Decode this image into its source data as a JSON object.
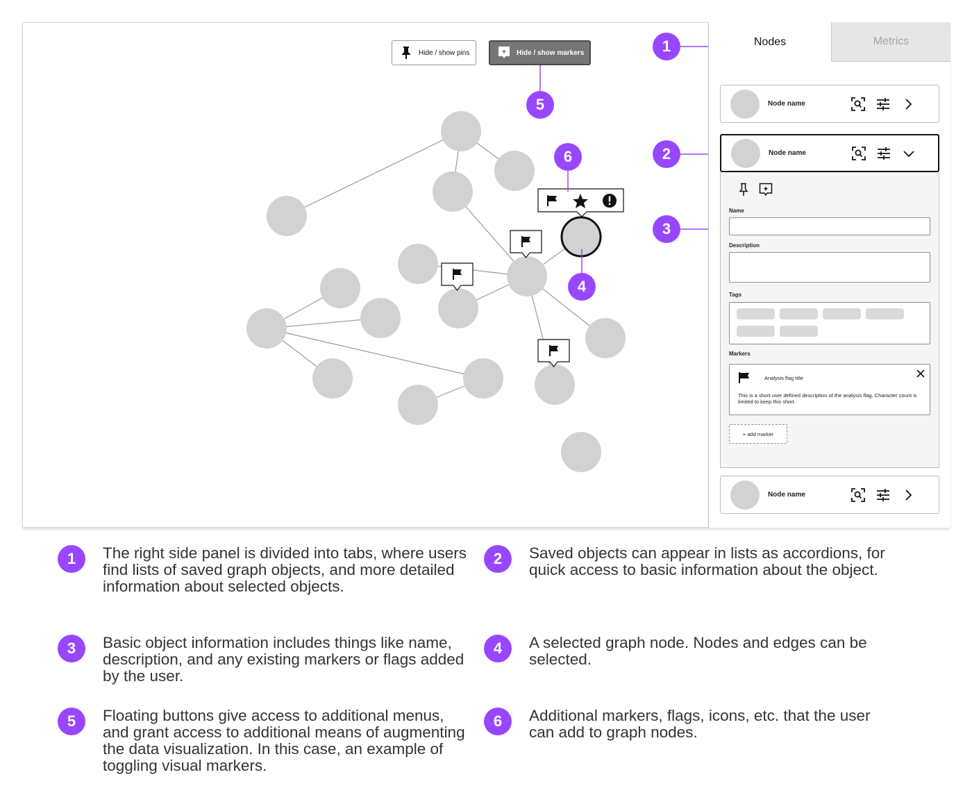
{
  "floating_buttons": {
    "pins_label": "Hide / show pins",
    "markers_label": "Hide / show markers"
  },
  "annotation_badges": [
    "1",
    "2",
    "3",
    "4",
    "5",
    "6"
  ],
  "side_panel": {
    "tabs": [
      {
        "label": "Nodes",
        "active": true
      },
      {
        "label": "Metrics",
        "active": false
      }
    ],
    "node_cards": [
      {
        "title": "Node name",
        "expanded": false
      },
      {
        "title": "Node name",
        "expanded": true
      },
      {
        "title": "Node name",
        "expanded": false
      }
    ],
    "details": {
      "name_label": "Name",
      "description_label": "Description",
      "tags_label": "Tags",
      "markers_label": "Markers",
      "marker": {
        "title": "Analysis flag title",
        "description": "This is a short user defined description of the analysis flag. Character count is limited to keep this short."
      },
      "add_marker_label": "+ add marker"
    }
  },
  "marker_palette": [
    "flag-icon",
    "star-icon",
    "alert-icon"
  ],
  "legend": [
    {
      "number": "1",
      "text": "The right side panel is divided into tabs, where users find lists of saved graph objects, and more detailed information about selected objects."
    },
    {
      "number": "2",
      "text": "Saved objects can appear in lists as accordions, for quick access to basic information about the object."
    },
    {
      "number": "3",
      "text": "Basic object information includes things like name, description, and any existing markers or flags added by the user."
    },
    {
      "number": "4",
      "text": "A selected graph node. Nodes and edges can be selected."
    },
    {
      "number": "5",
      "text": "Floating buttons give access to additional menus, and grant access to additional means of augmenting the data visualization. In this case, an example of toggling visual markers."
    },
    {
      "number": "6",
      "text": "Additional markers, flags, icons, etc. that the user can add to graph nodes."
    }
  ],
  "colors": {
    "accent": "#9747ff",
    "node_fill": "#d2d2d2",
    "edge": "#9a9a9a",
    "panel_border": "#bdbdbd",
    "inactive_tab": "#e6e6e6"
  }
}
